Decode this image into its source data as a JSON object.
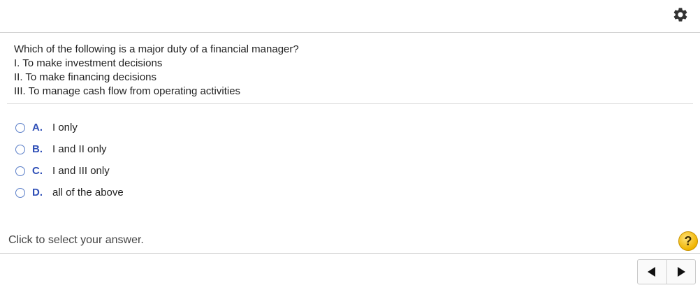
{
  "question": {
    "stem": "Which of the following is a major duty of a financial manager?",
    "statements": [
      "I.  To make investment decisions",
      "II.  To make financing decisions",
      "III.  To manage cash flow from operating activities"
    ]
  },
  "choices": [
    {
      "letter": "A.",
      "text": "I only"
    },
    {
      "letter": "B.",
      "text": "I and II only"
    },
    {
      "letter": "C.",
      "text": "I and III only"
    },
    {
      "letter": "D.",
      "text": "all of the above"
    }
  ],
  "footer": {
    "instruction": "Click to select your answer.",
    "help_symbol": "?"
  },
  "icons": {
    "settings": "gear-icon",
    "help": "help-icon",
    "previous": "previous-arrow-icon",
    "next": "next-arrow-icon"
  },
  "colors": {
    "choice_letter": "#2f4fb7",
    "radio_border": "#5a7ec8",
    "help_button": "#f0b400"
  }
}
